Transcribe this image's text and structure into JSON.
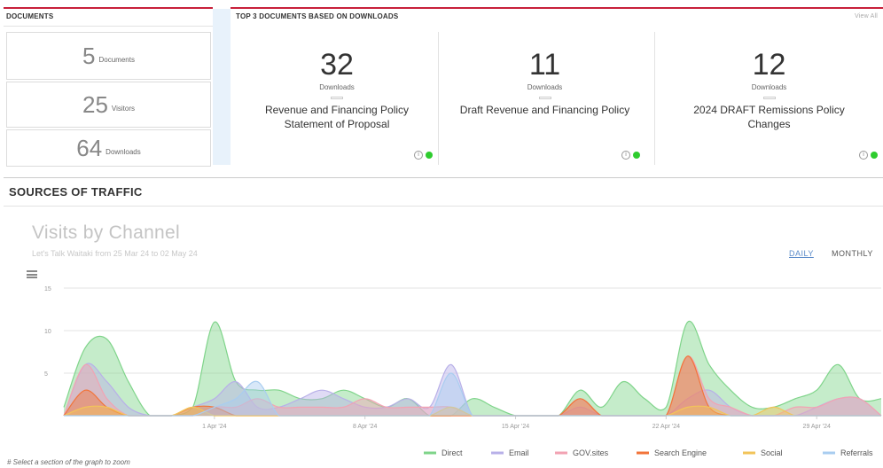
{
  "documents": {
    "heading": "DOCUMENTS",
    "stats": [
      {
        "value": "5",
        "label": "Documents"
      },
      {
        "value": "25",
        "label": "Visitors"
      },
      {
        "value": "64",
        "label": "Downloads"
      }
    ]
  },
  "top3": {
    "heading": "TOP 3 DOCUMENTS BASED ON DOWNLOADS",
    "view_all": "View All",
    "docs": [
      {
        "downloads": "32",
        "downloads_label": "Downloads",
        "title": "Revenue and Financing Policy Statement of Proposal"
      },
      {
        "downloads": "11",
        "downloads_label": "Downloads",
        "title": "Draft Revenue and Financing Policy"
      },
      {
        "downloads": "12",
        "downloads_label": "Downloads",
        "title": "2024 DRAFT Remissions Policy Changes"
      }
    ]
  },
  "sources": {
    "heading": "SOURCES OF TRAFFIC",
    "chart_title": "Visits by Channel",
    "chart_subtitle": "Let's Talk Waitaki from 25 Mar 24 to 02 May 24",
    "toggle_daily": "DAILY",
    "toggle_monthly": "MONTHLY",
    "hint": "# Select a section of the graph to zoom"
  },
  "chart_data": {
    "type": "area",
    "ylim": [
      0,
      15
    ],
    "yticks": [
      5,
      10,
      15
    ],
    "xticks": [
      "1 Apr '24",
      "8 Apr '24",
      "15 Apr '24",
      "22 Apr '24",
      "29 Apr '24"
    ],
    "x": [
      "25 Mar",
      "26 Mar",
      "27 Mar",
      "28 Mar",
      "29 Mar",
      "30 Mar",
      "31 Mar",
      "1 Apr",
      "2 Apr",
      "3 Apr",
      "4 Apr",
      "5 Apr",
      "6 Apr",
      "7 Apr",
      "8 Apr",
      "9 Apr",
      "10 Apr",
      "11 Apr",
      "12 Apr",
      "13 Apr",
      "14 Apr",
      "15 Apr",
      "16 Apr",
      "17 Apr",
      "18 Apr",
      "19 Apr",
      "20 Apr",
      "21 Apr",
      "22 Apr",
      "23 Apr",
      "24 Apr",
      "25 Apr",
      "26 Apr",
      "27 Apr",
      "28 Apr",
      "29 Apr",
      "30 Apr",
      "1 May",
      "2 May"
    ],
    "series": [
      {
        "name": "Direct",
        "color": "#7fd48a",
        "values": [
          1,
          8,
          9,
          4,
          0,
          0,
          1,
          11,
          4,
          3,
          3,
          2,
          2,
          3,
          2,
          1,
          2,
          0,
          0,
          2,
          1,
          0,
          0,
          0,
          3,
          1,
          4,
          2,
          1,
          11,
          6,
          3,
          1,
          1,
          2,
          3,
          6,
          2,
          2
        ]
      },
      {
        "name": "Email",
        "color": "#b8b0e8",
        "values": [
          0,
          6,
          4,
          1,
          0,
          0,
          1,
          2,
          4,
          1,
          1,
          2,
          3,
          2,
          1,
          1,
          2,
          1,
          6,
          0,
          0,
          0,
          0,
          0,
          1,
          0,
          0,
          0,
          0,
          2,
          3,
          1,
          0,
          0,
          0,
          1,
          2,
          2,
          0
        ]
      },
      {
        "name": "GOV.sites",
        "color": "#f2a3b3",
        "values": [
          0,
          6,
          2,
          0,
          0,
          0,
          0,
          1,
          1,
          2,
          1,
          1,
          1,
          1,
          2,
          1,
          1,
          1,
          1,
          0,
          0,
          0,
          0,
          0,
          2,
          0,
          0,
          0,
          0,
          7,
          2,
          1,
          0,
          0,
          1,
          1,
          2,
          2,
          0
        ]
      },
      {
        "name": "Search Engine",
        "color": "#f2743a",
        "values": [
          0,
          3,
          1,
          0,
          0,
          0,
          1,
          1,
          0,
          0,
          0,
          0,
          0,
          0,
          0,
          0,
          0,
          0,
          0,
          0,
          0,
          0,
          0,
          0,
          2,
          0,
          0,
          0,
          0,
          7,
          1,
          0,
          0,
          0,
          0,
          0,
          0,
          0,
          0
        ]
      },
      {
        "name": "Social",
        "color": "#f2c45a",
        "values": [
          0,
          1,
          1,
          0,
          0,
          0,
          1,
          0,
          0,
          0,
          0,
          0,
          0,
          0,
          0,
          0,
          0,
          0,
          1,
          0,
          0,
          0,
          0,
          0,
          0,
          0,
          0,
          0,
          0,
          1,
          1,
          0,
          0,
          1,
          0,
          0,
          0,
          0,
          0
        ]
      },
      {
        "name": "Referrals",
        "color": "#a9cdf0",
        "values": [
          0,
          0,
          0,
          0,
          0,
          0,
          0,
          1,
          2,
          4,
          0,
          0,
          0,
          0,
          0,
          0,
          0,
          0,
          5,
          0,
          0,
          0,
          0,
          0,
          0,
          0,
          0,
          0,
          0,
          0,
          0,
          0,
          0,
          0,
          0,
          0,
          0,
          0,
          0
        ]
      }
    ]
  }
}
